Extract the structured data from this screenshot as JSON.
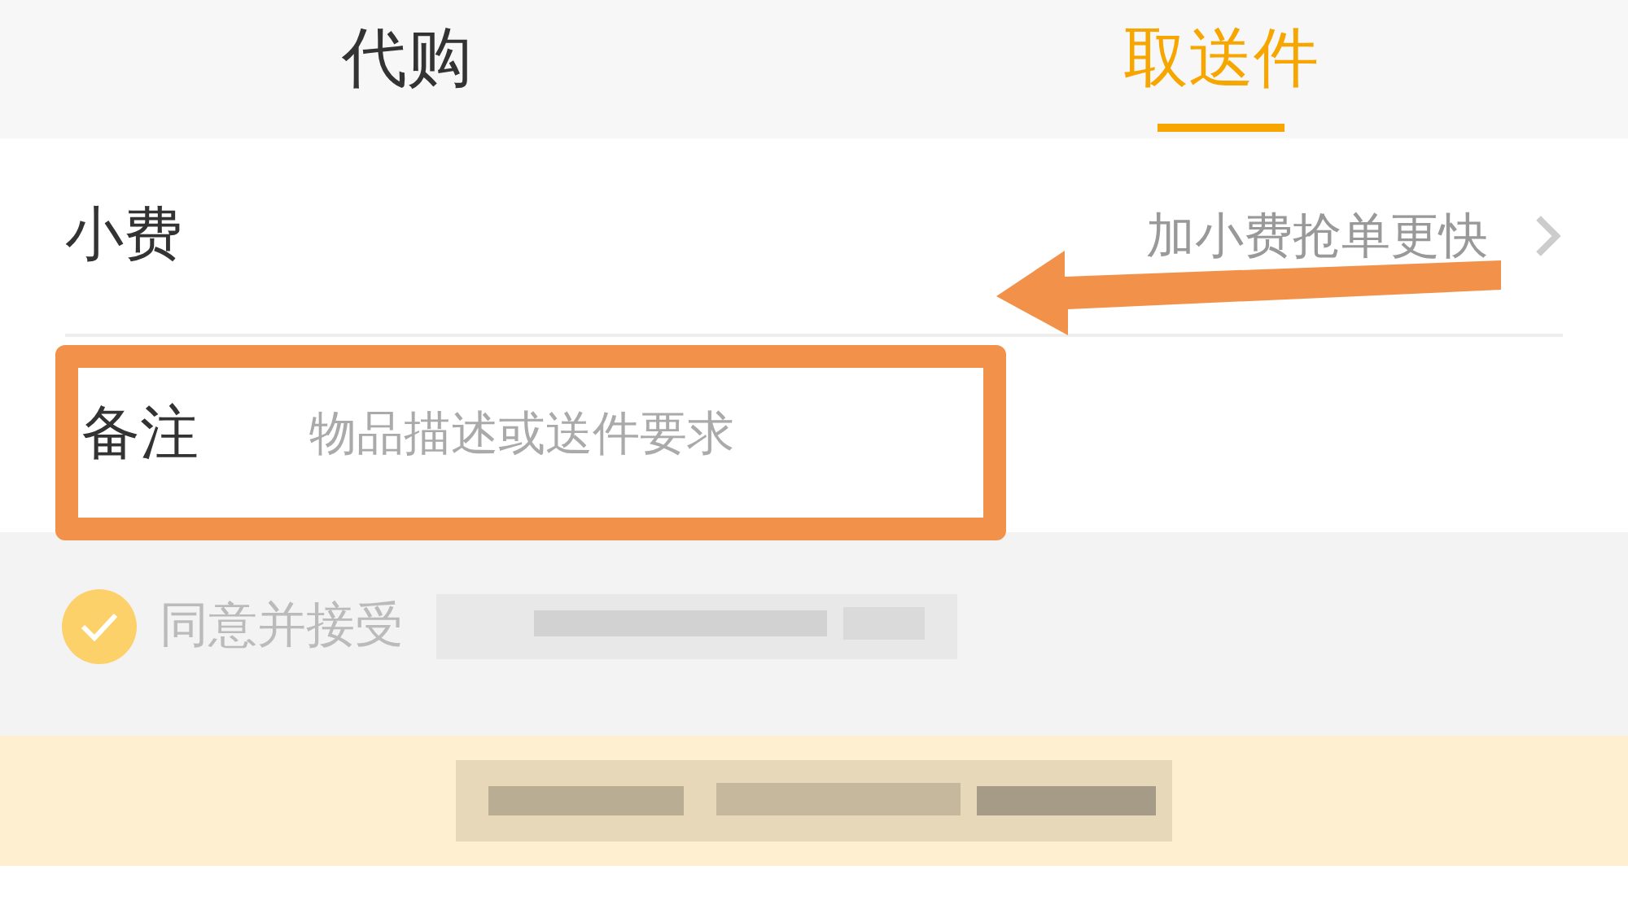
{
  "tabs": [
    {
      "label": "代购",
      "selected": false
    },
    {
      "label": "取送件",
      "selected": true
    }
  ],
  "tip_row": {
    "label": "小费",
    "hint": "加小费抢单更快"
  },
  "note_row": {
    "label": "备注",
    "placeholder": "物品描述或送件要求"
  },
  "agreement": {
    "checked": true,
    "text": "同意并接受"
  }
}
